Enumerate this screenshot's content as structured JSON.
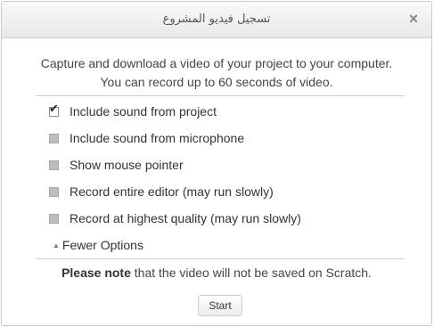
{
  "dialog": {
    "title": "تسجيل فيديو المشروع",
    "close_glyph": "×",
    "description_line1": "Capture and download a video of your project to your computer.",
    "description_line2": "You can record up to 60 seconds of video.",
    "options": [
      {
        "label": "Include sound from project",
        "checked": true
      },
      {
        "label": "Include sound from microphone",
        "checked": false
      },
      {
        "label": "Show mouse pointer",
        "checked": false
      },
      {
        "label": "Record entire editor (may run slowly)",
        "checked": false
      },
      {
        "label": "Record at highest quality (may run slowly)",
        "checked": false
      }
    ],
    "fewer_options_label": "Fewer Options",
    "note_bold": "Please note",
    "note_rest": " that the video will not be saved on Scratch.",
    "start_label": "Start"
  }
}
